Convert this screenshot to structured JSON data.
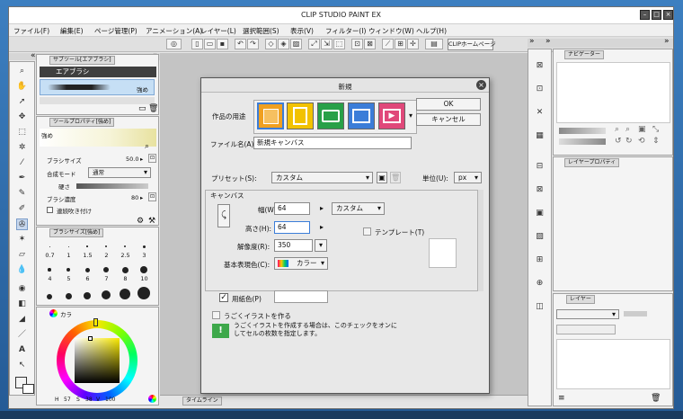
{
  "app": {
    "title": "CLIP STUDIO PAINT EX"
  },
  "menu": [
    "ファイル(F)",
    "編集(E)",
    "ページ管理(P)",
    "アニメーション(A)",
    "レイヤー(L)",
    "選択範囲(S)",
    "表示(V)",
    "フィルター(I)",
    "ウィンドウ(W)",
    "ヘルプ(H)"
  ],
  "toolbar": {
    "clip_home": "CLIPホームページ"
  },
  "left": {
    "subtool_tab": "サブツール[エアブラシ]",
    "subtool_group": "エアブラシ",
    "subtool_item": "強め",
    "toolprop_tab": "ツールプロパティ[強め]",
    "toolprop_preview": "強め",
    "brush_size_label": "ブラシサイズ",
    "brush_size_value": "50.0",
    "blend_label": "合成モード",
    "blend_value": "通常",
    "hardness_label": "硬さ",
    "density_label": "ブラシ濃度",
    "density_value": "80",
    "continuous_label": "連続吹き付け",
    "brushsize_tab": "ブラシサイズ[強め]",
    "sizes_row1": [
      "0.7",
      "1",
      "1.5",
      "2",
      "2.5",
      "3"
    ],
    "sizes_row2": [
      "4",
      "5",
      "6",
      "7",
      "8",
      "10"
    ],
    "color_tab": "カラ",
    "hsv": [
      "57",
      "38",
      "100"
    ]
  },
  "right": {
    "navigator_tab": "ナビゲーター",
    "layerprop_tab": "レイヤープロパティ",
    "layer_tab": "レイヤー"
  },
  "timeline_tab": "タイムライン",
  "dialog": {
    "title": "新規",
    "usage_label": "作品の用途",
    "ok": "OK",
    "cancel": "キャンセル",
    "filename_label": "ファイル名(A):",
    "filename_value": "新規キャンバス",
    "preset_label": "プリセット(S):",
    "preset_value": "カスタム",
    "unit_label": "単位(U):",
    "unit_value": "px",
    "canvas_legend": "キャンバス",
    "width_label": "幅(W):",
    "width_value": "64",
    "height_label": "高さ(H):",
    "height_value": "64",
    "size_preset": "カスタム",
    "resolution_label": "解像度(R):",
    "resolution_value": "350",
    "template_label": "テンプレート(T)",
    "basic_color_label": "基本表現色(C):",
    "basic_color_value": "カラー",
    "paper_color_label": "用紙色(P)",
    "animation_label": "うごくイラストを作る",
    "animation_help": "うごくイラストを作成する場合は、このチェックをオンにしてセルの枚数を指定します。",
    "help_icon": "!"
  },
  "colors": {
    "accent": "#3b7dd8",
    "current_color": "#f8f6b0",
    "paper_color": "#ffffff"
  }
}
